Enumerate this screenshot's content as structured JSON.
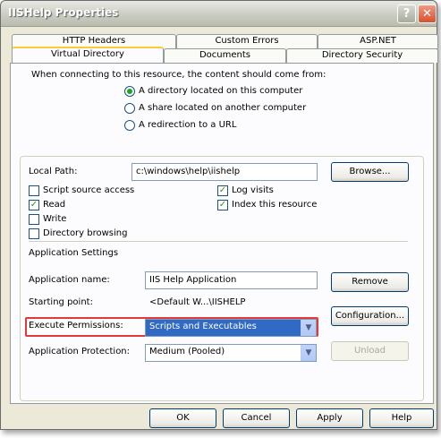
{
  "window": {
    "title": "IISHelp Properties",
    "help_glyph": "?",
    "close_glyph": "✕"
  },
  "tabs": {
    "row1": [
      "HTTP Headers",
      "Custom Errors",
      "ASP.NET"
    ],
    "row2": [
      "Virtual Directory",
      "Documents",
      "Directory Security"
    ],
    "active": "Virtual Directory"
  },
  "content_source": {
    "heading": "When connecting to this resource, the content should come from:",
    "options": [
      {
        "label": "A directory located on this computer",
        "checked": true
      },
      {
        "label": "A share located on another computer",
        "checked": false
      },
      {
        "label": "A redirection to a URL",
        "checked": false
      }
    ]
  },
  "local_path": {
    "label": "Local Path:",
    "value": "c:\\windows\\help\\iishelp",
    "browse_label": "Browse..."
  },
  "permissions": {
    "script_source_access": {
      "label": "Script source access",
      "checked": false
    },
    "read": {
      "label": "Read",
      "checked": true
    },
    "write": {
      "label": "Write",
      "checked": false
    },
    "directory_browsing": {
      "label": "Directory browsing",
      "checked": false
    },
    "log_visits": {
      "label": "Log visits",
      "checked": true
    },
    "index_resource": {
      "label": "Index this resource",
      "checked": true
    }
  },
  "app_settings": {
    "heading": "Application Settings",
    "name_label": "Application name:",
    "name_value": "IIS Help Application",
    "remove_label": "Remove",
    "starting_point_label": "Starting point:",
    "starting_point_value": "<Default W...\\IISHELP",
    "configuration_label": "Configuration...",
    "execute_label": "Execute Permissions:",
    "execute_value": "Scripts and Executables",
    "protection_label": "Application Protection:",
    "protection_value": "Medium (Pooled)",
    "unload_label": "Unload"
  },
  "footer": {
    "ok": "OK",
    "cancel": "Cancel",
    "apply": "Apply",
    "help": "Help"
  },
  "colors": {
    "highlight": "#e03a3a",
    "selection": "#316ac5",
    "active_tab_accent": "#ffc83c"
  }
}
